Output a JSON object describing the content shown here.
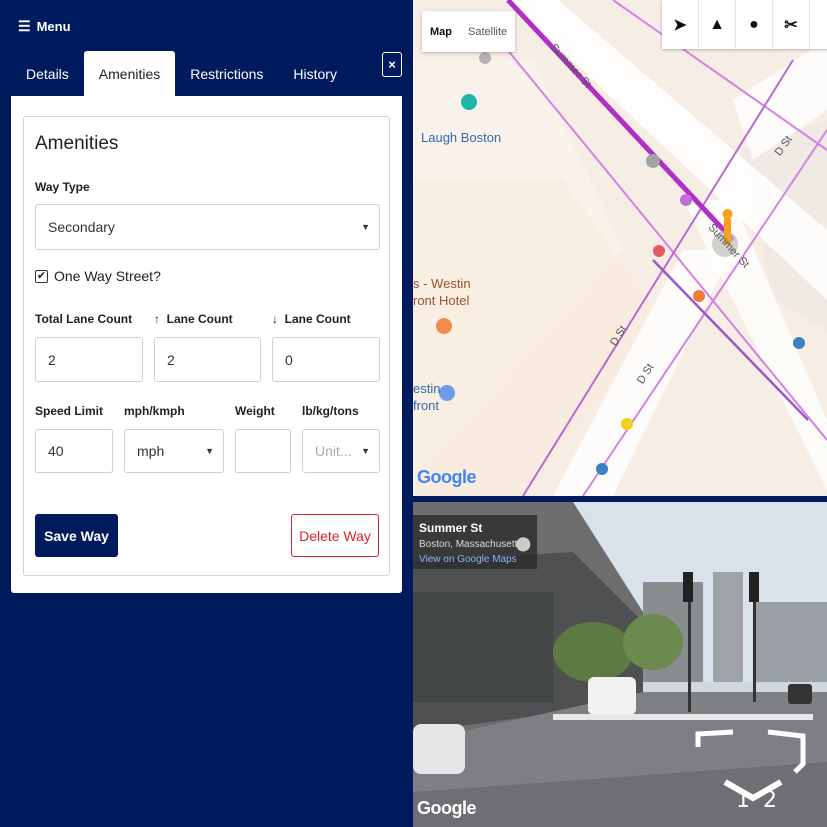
{
  "menu": {
    "label": "Menu"
  },
  "tabs": [
    {
      "label": "Details",
      "active": false
    },
    {
      "label": "Amenities",
      "active": true
    },
    {
      "label": "Restrictions",
      "active": false
    },
    {
      "label": "History",
      "active": false
    }
  ],
  "close": {
    "icon": "close-icon",
    "glyph": "×"
  },
  "form": {
    "title": "Amenities",
    "way_type": {
      "label": "Way Type",
      "value": "Secondary"
    },
    "one_way": {
      "label": "One Way Street?",
      "checked": true
    },
    "total_lane": {
      "label": "Total Lane Count",
      "value": "2"
    },
    "up_lane": {
      "label": "Lane Count",
      "value": "2",
      "arrow": "↑"
    },
    "down_lane": {
      "label": "Lane Count",
      "value": "0",
      "arrow": "↓"
    },
    "speed_limit": {
      "label": "Speed Limit",
      "value": "40"
    },
    "speed_unit": {
      "label": "mph/kmph",
      "value": "mph"
    },
    "weight": {
      "label": "Weight",
      "value": ""
    },
    "weight_unit": {
      "label": "lb/kg/tons",
      "placeholder": "Unit..."
    },
    "save_label": "Save Way",
    "delete_label": "Delete Way"
  },
  "map": {
    "toggle": {
      "map": "Map",
      "satellite": "Satellite"
    },
    "places": {
      "laugh": "Laugh Boston",
      "westin1": "s - Westin",
      "westin2": "ront Hotel",
      "westin3": "estin",
      "westin4": "front"
    },
    "streets": {
      "summer1": "Summer St",
      "summer2": "Summer St",
      "d1": "D St",
      "d2": "D St",
      "d3": "D St"
    },
    "google": "Google",
    "tools": [
      "cursor-icon",
      "road-icon",
      "marker-icon",
      "scissors-icon"
    ],
    "colors": {
      "route": "#b12fc4",
      "secondary_route": "#d580e6",
      "accent": "#001a5e"
    }
  },
  "streetview": {
    "title": "Summer St",
    "subtitle": "Boston, Massachusetts",
    "link": "View on Google Maps",
    "google": "Google",
    "nav_1": "1",
    "nav_2": "2"
  }
}
